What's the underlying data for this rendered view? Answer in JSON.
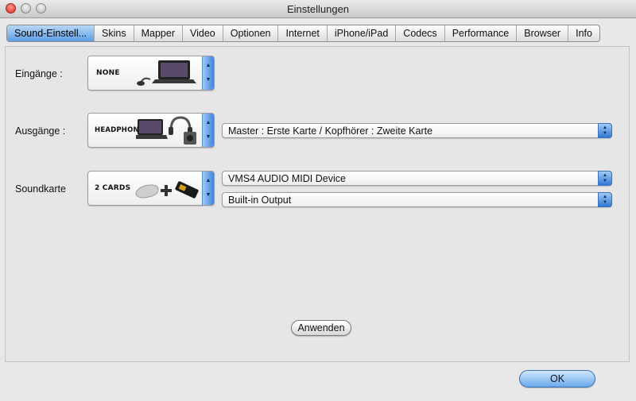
{
  "window": {
    "title": "Einstellungen"
  },
  "tabs": [
    "Sound-Einstell...",
    "Skins",
    "Mapper",
    "Video",
    "Optionen",
    "Internet",
    "iPhone/iPad",
    "Codecs",
    "Performance",
    "Browser",
    "Info"
  ],
  "inputs_row": {
    "label": "Eingänge :",
    "preset_text": "NONE"
  },
  "outputs_row": {
    "label": "Ausgänge :",
    "preset_text": "HEADPHONES",
    "select_value": "Master : Erste Karte / Kopfhörer : Zweite Karte"
  },
  "soundcard_row": {
    "label": "Soundkarte",
    "preset_text": "2 CARDS",
    "device_select_value": "VMS4 AUDIO MIDI Device",
    "output_select_value": "Built-in Output"
  },
  "buttons": {
    "apply": "Anwenden",
    "ok": "OK"
  },
  "colors": {
    "accent": "#3f86dc",
    "close_light": "#d8261b"
  },
  "icons": {
    "stepper": "up-down-stepper-icon",
    "popup": "popup-arrows-icon"
  }
}
